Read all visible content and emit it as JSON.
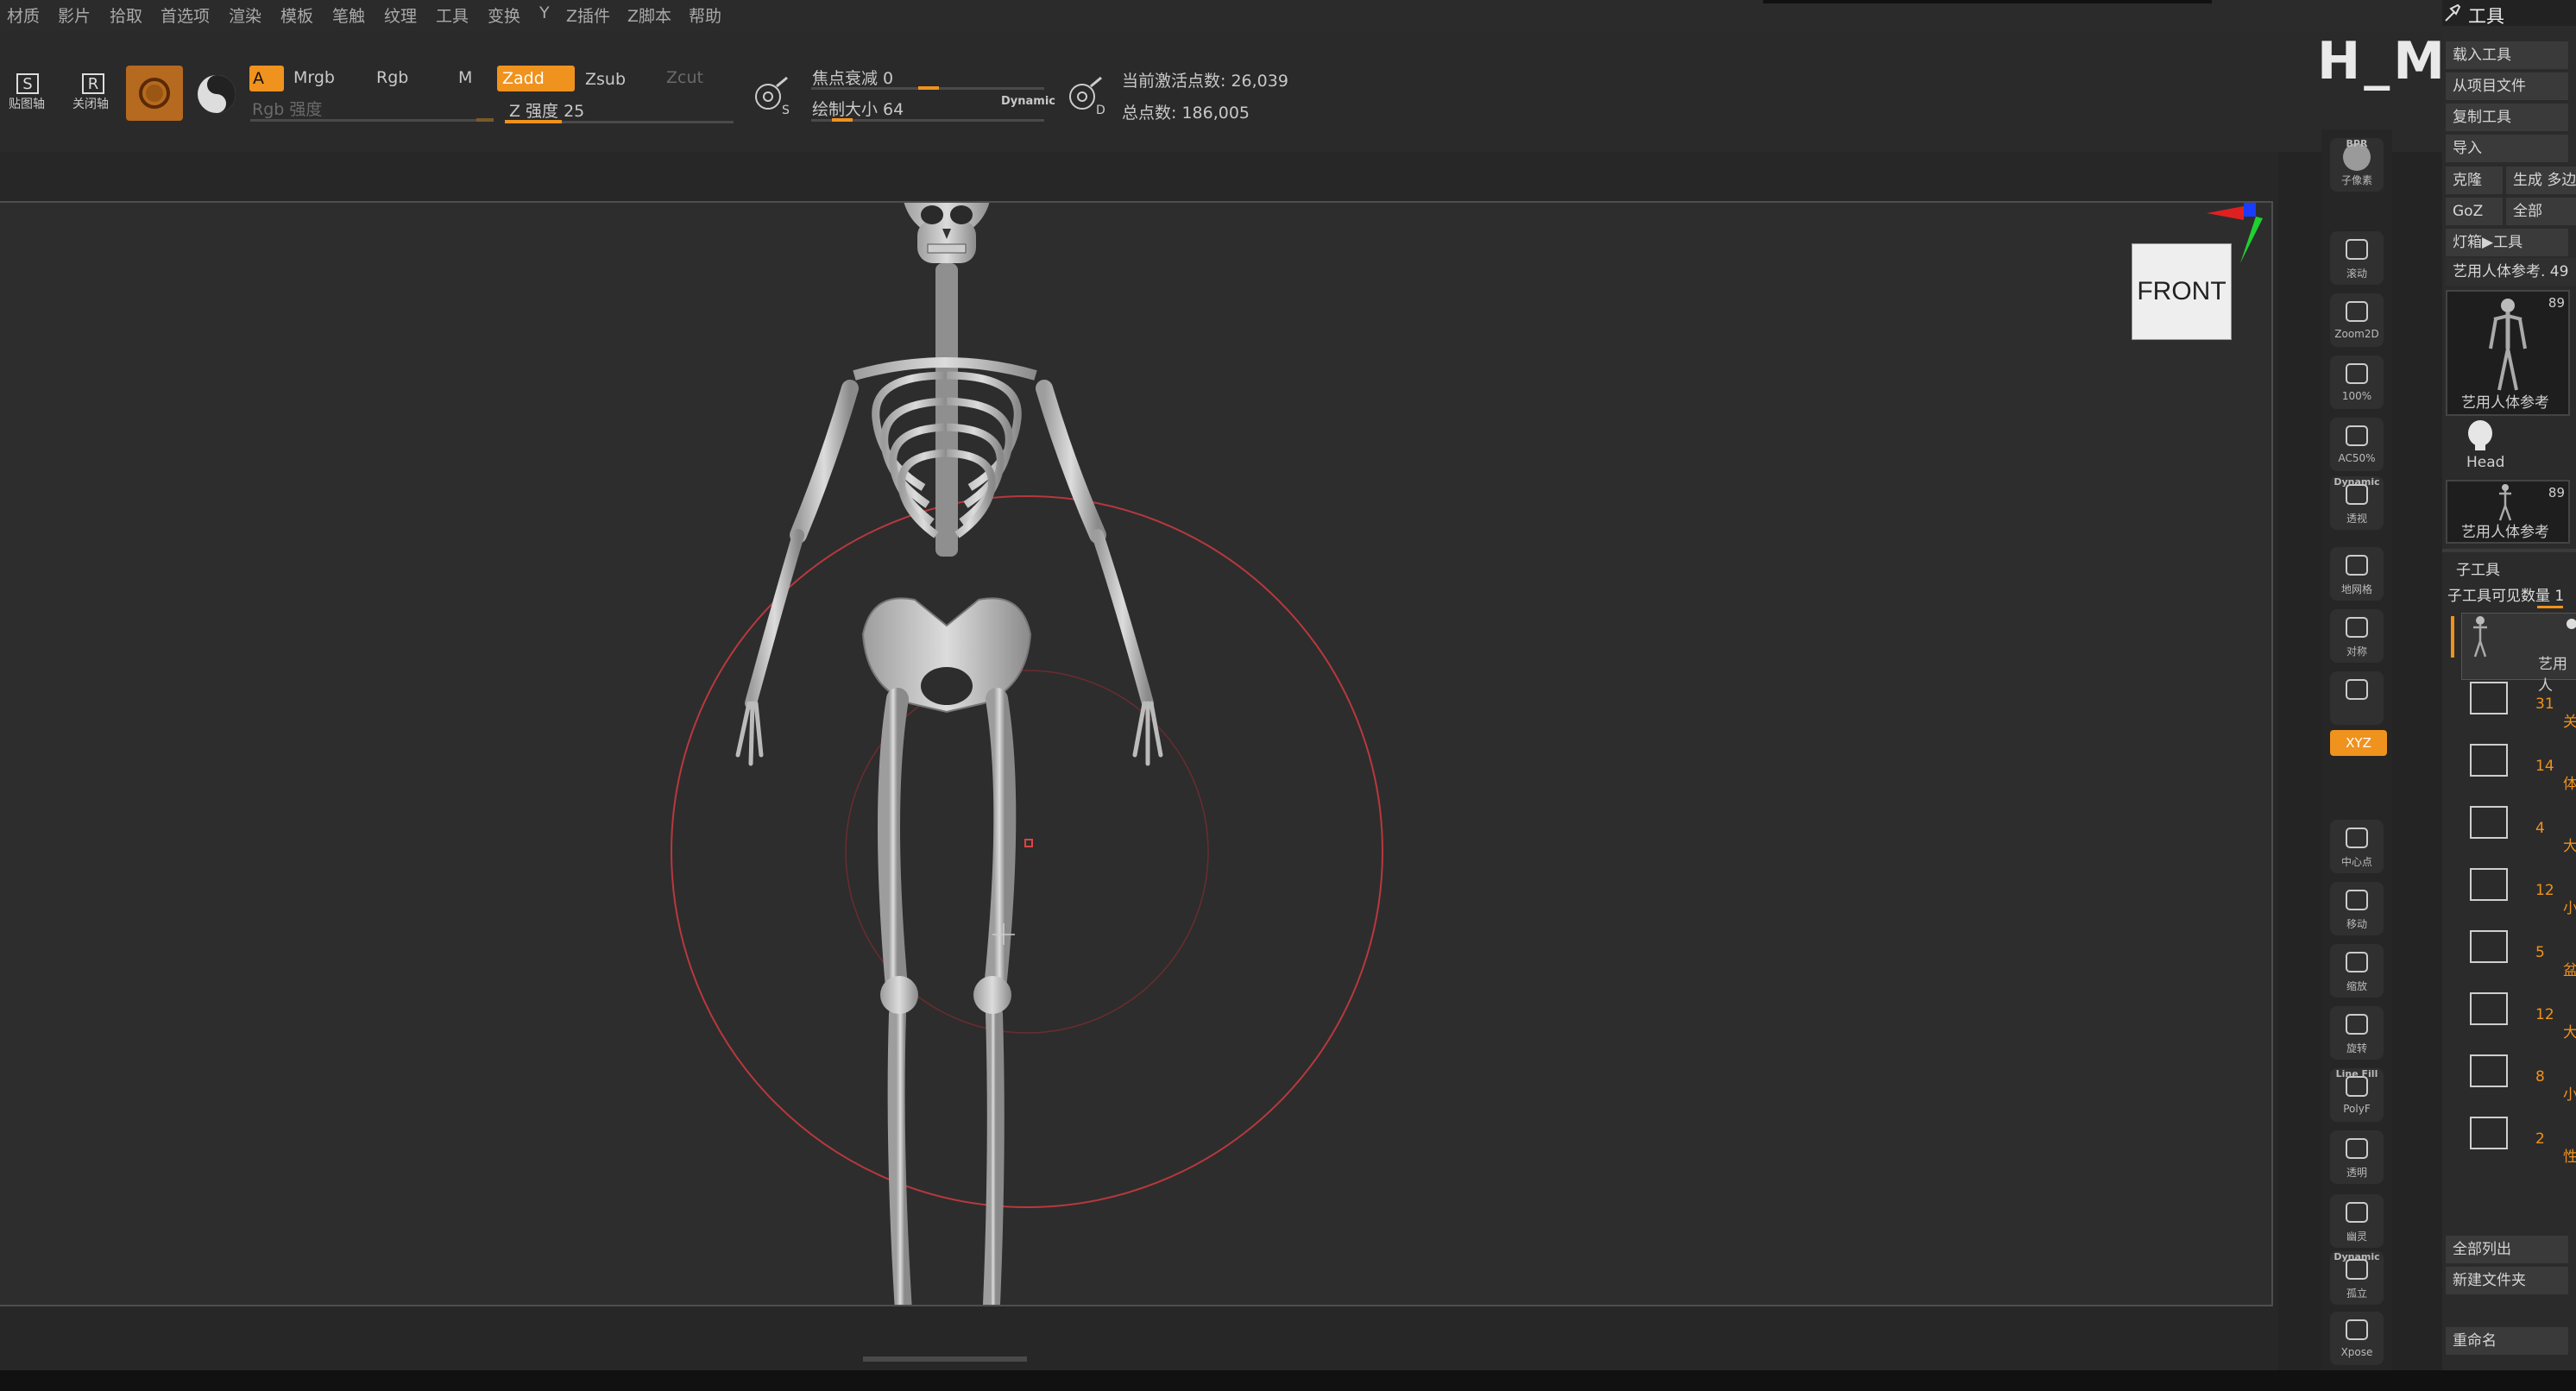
{
  "menu": {
    "items": [
      "材质",
      "影片",
      "拾取",
      "首选项",
      "渲染",
      "模板",
      "笔触",
      "纹理",
      "工具",
      "变换",
      "Y",
      "Z插件",
      "Z脚本",
      "帮助"
    ]
  },
  "toolbar": {
    "btn_s_label": "S",
    "btn_s_caption": "贴图轴",
    "btn_r_label": "R",
    "btn_r_caption": "关闭轴",
    "mode_a": "A",
    "mode_mrgb": "Mrgb",
    "mode_rgb": "Rgb",
    "mode_m": "M",
    "zadd": "Zadd",
    "zsub": "Zsub",
    "zcut": "Zcut",
    "rgb_intensity": "Rgb 强度",
    "z_intensity": "Z 强度 25",
    "z_intensity_value": 25,
    "focal_shift": "焦点衰减 0",
    "focal_shift_value": 0,
    "draw_size": "绘制大小 64",
    "draw_size_value": 64,
    "dynamic_label": "Dynamic",
    "active_points": "当前激活点数: 26,039",
    "total_points": "总点数: 186,005",
    "s_icon_letter": "S",
    "d_icon_letter": "D"
  },
  "viewport": {
    "front_label": "FRONT"
  },
  "watermark": "H_M_Z bi",
  "shelf": {
    "buttons": [
      {
        "label": "BPR",
        "caption": "子像素"
      },
      {
        "label": "",
        "caption": "滚动"
      },
      {
        "label": "",
        "caption": "Zoom2D"
      },
      {
        "label": "",
        "caption": "100%"
      },
      {
        "label": "",
        "caption": "AC50%"
      },
      {
        "label": "Dynamic",
        "caption": "透视"
      },
      {
        "label": "",
        "caption": "地网格"
      },
      {
        "label": "",
        "caption": "对称"
      },
      {
        "label": "",
        "caption": ""
      },
      {
        "label": "XYZ",
        "caption": ""
      },
      {
        "label": "",
        "caption": "中心点"
      },
      {
        "label": "",
        "caption": "移动"
      },
      {
        "label": "",
        "caption": "缩放"
      },
      {
        "label": "",
        "caption": "旋转"
      },
      {
        "label": "Line Fill",
        "caption": "PolyF"
      },
      {
        "label": "",
        "caption": "透明"
      },
      {
        "label": "",
        "caption": "幽灵"
      },
      {
        "label": "Dynamic",
        "caption": "孤立"
      },
      {
        "label": "",
        "caption": "Xpose"
      }
    ]
  },
  "tool_panel": {
    "title": "工具",
    "load_tool": "载入工具",
    "from_project": "从项目文件",
    "copy_tool": "复制工具",
    "import": "导入",
    "clone": "克隆",
    "make_polymesh": "生成 多边",
    "goz": "GoZ",
    "all": "全部",
    "lightbox_tool": "灯箱▶工具",
    "current_tool": "艺用人体参考. 49",
    "thumb1_label": "艺用人体参考",
    "thumb1_count": "89",
    "head_label": "Head",
    "thumb2_label": "艺用人体参考",
    "thumb2_count": "89",
    "subtool_header": "子工具",
    "subtool_visible": "子工具可见数量 1",
    "subtool_active": "艺用人",
    "subtools": [
      {
        "count": "31",
        "char": "关"
      },
      {
        "count": "14",
        "char": "体"
      },
      {
        "count": "4",
        "char": "大"
      },
      {
        "count": "12",
        "char": "小"
      },
      {
        "count": "5",
        "char": "盆"
      },
      {
        "count": "12",
        "char": "大"
      },
      {
        "count": "8",
        "char": "小"
      },
      {
        "count": "2",
        "char": "性别"
      }
    ],
    "list_all": "全部列出",
    "new_folder": "新建文件夹",
    "rename": "重命名"
  },
  "colors": {
    "accent": "#f0921e",
    "background": "#242424",
    "brush_circle": "#b8383d"
  }
}
